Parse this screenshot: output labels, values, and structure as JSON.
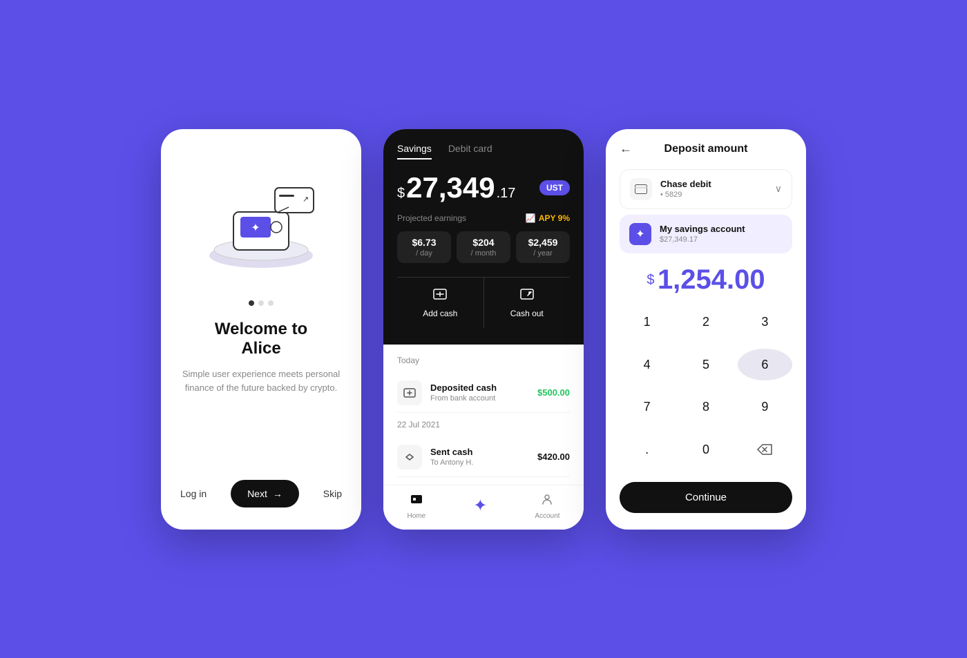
{
  "background": "#5B4FE8",
  "screen1": {
    "welcome_title": "Welcome to\nAlice",
    "subtitle": "Simple user experience meets personal finance of the future backed by crypto.",
    "login_label": "Log in",
    "next_label": "Next",
    "skip_label": "Skip",
    "dots": [
      "active",
      "inactive",
      "inactive"
    ]
  },
  "screen2": {
    "tab_savings": "Savings",
    "tab_debit": "Debit card",
    "balance_sign": "$",
    "balance_main": "27,349",
    "balance_cents": ".17",
    "currency_badge": "UST",
    "projected_label": "Projected earnings",
    "apy_label": "APY 9%",
    "earnings": [
      {
        "amount": "$6.73",
        "period": "/ day"
      },
      {
        "amount": "$204",
        "period": "/ month"
      },
      {
        "amount": "$2,459",
        "period": "/ year"
      }
    ],
    "actions": [
      {
        "label": "Add cash",
        "icon": "⊞"
      },
      {
        "label": "Cash out",
        "icon": "↗"
      }
    ],
    "today_label": "Today",
    "transactions": [
      {
        "title": "Deposited cash",
        "subtitle": "From bank account",
        "amount": "$500.00",
        "type": "positive"
      }
    ],
    "date_section": "22 Jul 2021",
    "transactions2": [
      {
        "title": "Sent cash",
        "subtitle": "To Antony H.",
        "amount": "$420.00",
        "type": "negative"
      }
    ],
    "nav": [
      {
        "label": "Home",
        "icon": "⊡"
      },
      {
        "label": "",
        "icon": "✦"
      },
      {
        "label": "Account",
        "icon": "⏱"
      }
    ]
  },
  "screen3": {
    "title": "Deposit amount",
    "back_icon": "←",
    "account1": {
      "name": "Chase debit",
      "detail": "• 5829",
      "icon": "💳"
    },
    "account2": {
      "name": "My savings account",
      "detail": "$27,349.17",
      "icon": "✦"
    },
    "amount_sign": "$",
    "amount_value": "1,254.00",
    "numpad": [
      "1",
      "2",
      "3",
      "4",
      "5",
      "6",
      "7",
      "8",
      "9",
      ".",
      "0",
      "⌫"
    ],
    "continue_label": "Continue"
  }
}
